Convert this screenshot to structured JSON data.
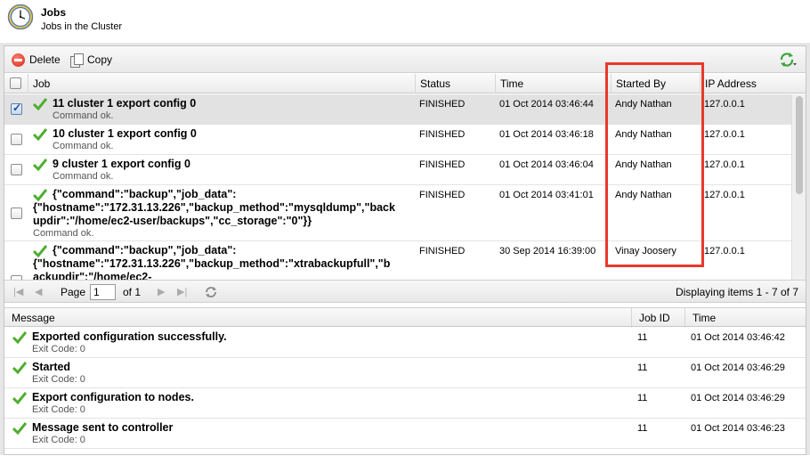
{
  "header": {
    "title": "Jobs",
    "subtitle": "Jobs in the Cluster"
  },
  "toolbar": {
    "delete_label": "Delete",
    "copy_label": "Copy"
  },
  "jobs_grid": {
    "columns": [
      "Job",
      "Status",
      "Time",
      "Started By",
      "IP Address"
    ],
    "rows": [
      {
        "title": "11 cluster 1 export config 0",
        "sub": "Command ok.",
        "status": "FINISHED",
        "time": "01 Oct 2014 03:46:44",
        "started_by": "Andy Nathan",
        "ip": "127.0.0.1",
        "checked": true
      },
      {
        "title": "10 cluster 1 export config 0",
        "sub": "Command ok.",
        "status": "FINISHED",
        "time": "01 Oct 2014 03:46:18",
        "started_by": "Andy Nathan",
        "ip": "127.0.0.1",
        "checked": false
      },
      {
        "title": "9 cluster 1 export config 0",
        "sub": "Command ok.",
        "status": "FINISHED",
        "time": "01 Oct 2014 03:46:04",
        "started_by": "Andy Nathan",
        "ip": "127.0.0.1",
        "checked": false
      },
      {
        "title_line1": "{\"command\":\"backup\",\"job_data\":",
        "title_line2": "{\"hostname\":\"172.31.13.226\",\"backup_method\":\"mysqldump\",\"back",
        "title_line3": "updir\":\"/home/ec2-user/backups\",\"cc_storage\":\"0\"}}",
        "sub": "Command ok.",
        "status": "FINISHED",
        "time": "01 Oct 2014 03:41:01",
        "started_by": "Andy Nathan",
        "ip": "127.0.0.1",
        "checked": false
      },
      {
        "title_line1": "{\"command\":\"backup\",\"job_data\":",
        "title_line2": "{\"hostname\":\"172.31.13.226\",\"backup_method\":\"xtrabackupfull\",\"b",
        "title_line3": "ackupdir\":\"/home/ec2-",
        "status": "FINISHED",
        "time": "30 Sep 2014 16:39:00",
        "started_by": "Vinay Joosery",
        "ip": "127.0.0.1",
        "checked": false
      }
    ]
  },
  "pager": {
    "page_label": "Page",
    "page_value": "1",
    "of_label": "of 1",
    "summary": "Displaying items 1 - 7 of 7"
  },
  "messages_grid": {
    "columns": [
      "Message",
      "Job ID",
      "Time"
    ],
    "rows": [
      {
        "title": "Exported configuration successfully.",
        "sub": "Exit Code: 0",
        "job_id": "11",
        "time": "01 Oct 2014 03:46:42"
      },
      {
        "title": "Started",
        "sub": "Exit Code: 0",
        "job_id": "11",
        "time": "01 Oct 2014 03:46:29"
      },
      {
        "title": "Export configuration to nodes.",
        "sub": "Exit Code: 0",
        "job_id": "11",
        "time": "01 Oct 2014 03:46:29"
      },
      {
        "title": "Message sent to controller",
        "sub": "Exit Code: 0",
        "job_id": "11",
        "time": "01 Oct 2014 03:46:23"
      }
    ]
  }
}
